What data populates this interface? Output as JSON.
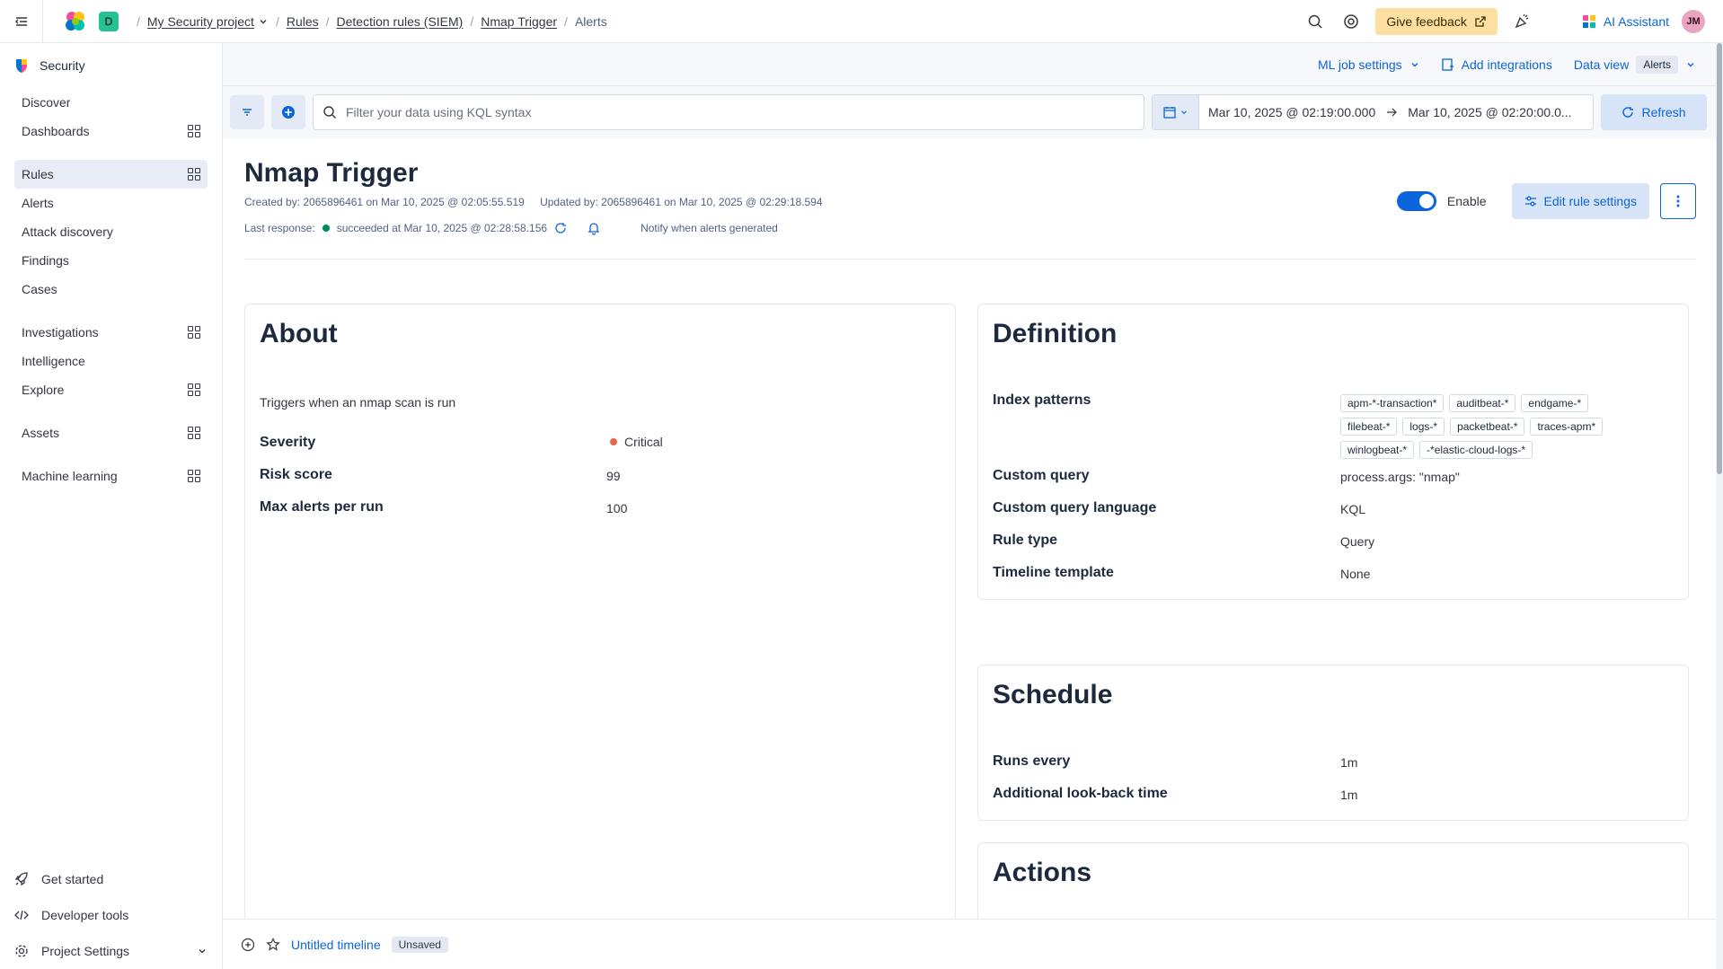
{
  "breadcrumbs": {
    "space": "D",
    "project": "My Security project",
    "rules": "Rules",
    "detection": "Detection rules (SIEM)",
    "rule": "Nmap Trigger",
    "current": "Alerts"
  },
  "header": {
    "feedback": "Give feedback",
    "ai": "AI Assistant",
    "avatar": "JM"
  },
  "sidebar": {
    "title": "Security",
    "items": [
      {
        "label": "Discover"
      },
      {
        "label": "Dashboards"
      },
      {
        "label": "Rules"
      },
      {
        "label": "Alerts"
      },
      {
        "label": "Attack discovery"
      },
      {
        "label": "Findings"
      },
      {
        "label": "Cases"
      },
      {
        "label": "Investigations"
      },
      {
        "label": "Intelligence"
      },
      {
        "label": "Explore"
      },
      {
        "label": "Assets"
      },
      {
        "label": "Machine learning"
      }
    ],
    "bottom": {
      "get_started": "Get started",
      "dev_tools": "Developer tools",
      "project_settings": "Project Settings"
    }
  },
  "subheader": {
    "ml": "ML job settings",
    "integrations": "Add integrations",
    "data_view": "Data view",
    "data_view_value": "Alerts"
  },
  "querybar": {
    "placeholder": "Filter your data using KQL syntax",
    "start": "Mar 10, 2025 @ 02:19:00.000",
    "end": "Mar 10, 2025 @ 02:20:00.0...",
    "refresh": "Refresh"
  },
  "rule": {
    "title": "Nmap Trigger",
    "created": "Created by: 2065896461 on Mar 10, 2025 @ 02:05:55.519",
    "updated": "Updated by: 2065896461 on Mar 10, 2025 @ 02:29:18.594",
    "last_response_label": "Last response:",
    "last_response": "succeeded at Mar 10, 2025 @ 02:28:58.156",
    "notify": "Notify when alerts generated",
    "enable": "Enable",
    "edit": "Edit rule settings"
  },
  "about": {
    "heading": "About",
    "description": "Triggers when an nmap scan is run",
    "severity_label": "Severity",
    "severity": "Critical",
    "risk_label": "Risk score",
    "risk": "99",
    "max_label": "Max alerts per run",
    "max": "100"
  },
  "definition": {
    "heading": "Definition",
    "index_label": "Index patterns",
    "index_patterns": [
      "apm-*-transaction*",
      "auditbeat-*",
      "endgame-*",
      "filebeat-*",
      "logs-*",
      "packetbeat-*",
      "traces-apm*",
      "winlogbeat-*",
      "-*elastic-cloud-logs-*"
    ],
    "query_label": "Custom query",
    "query": "process.args: \"nmap\"",
    "lang_label": "Custom query language",
    "lang": "KQL",
    "type_label": "Rule type",
    "type": "Query",
    "template_label": "Timeline template",
    "template": "None"
  },
  "schedule": {
    "heading": "Schedule",
    "runs_label": "Runs every",
    "runs": "1m",
    "lookback_label": "Additional look-back time",
    "lookback": "1m"
  },
  "actions": {
    "heading": "Actions"
  },
  "timeline": {
    "name": "Untitled timeline",
    "status": "Unsaved"
  }
}
